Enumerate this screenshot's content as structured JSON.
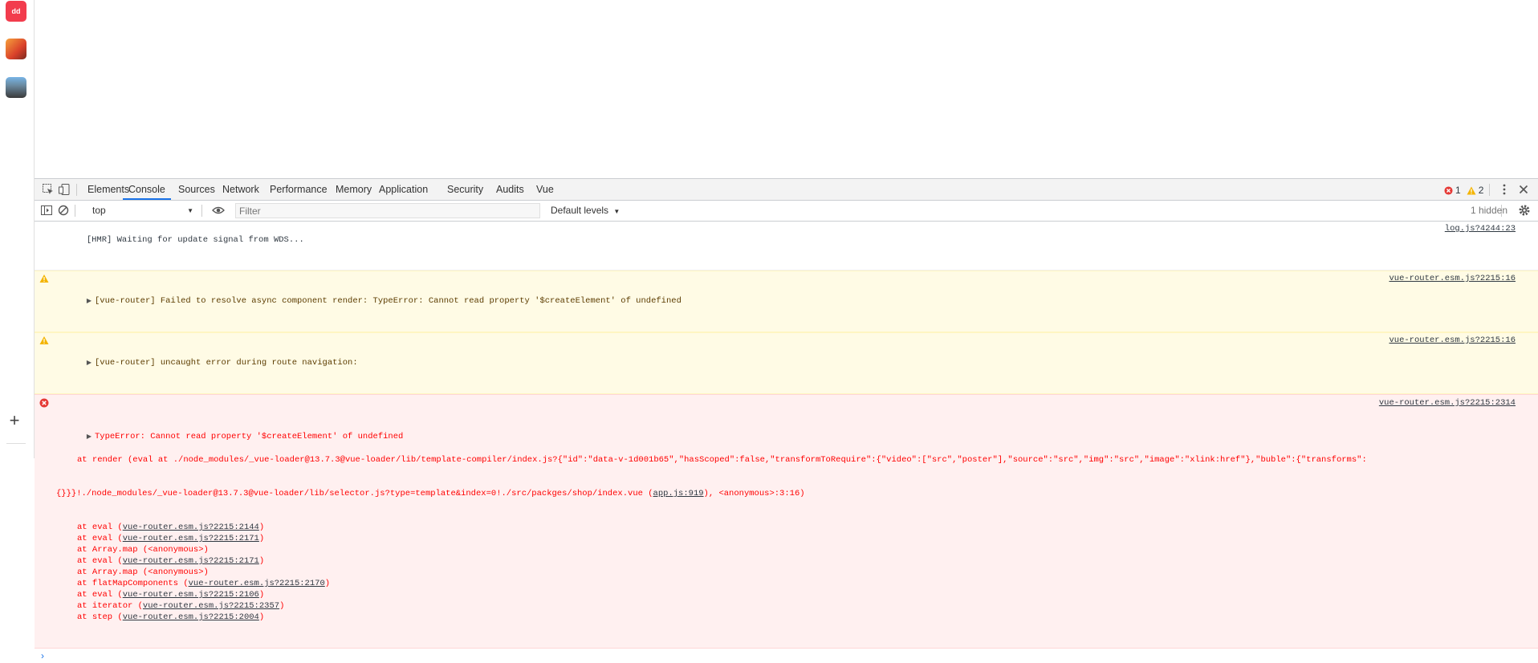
{
  "sidebar": {
    "apps": [
      {
        "name": "app-1",
        "label": "dd"
      },
      {
        "name": "app-2",
        "label": ""
      },
      {
        "name": "app-3",
        "label": ""
      }
    ],
    "add_label": "+"
  },
  "devtools": {
    "tabs": [
      "Elements",
      "Console",
      "Sources",
      "Network",
      "Performance",
      "Memory",
      "Application",
      "Security",
      "Audits",
      "Vue"
    ],
    "active_tab": "Console",
    "error_count": "1",
    "warning_count": "2",
    "toolbar": {
      "context": "top",
      "filter_placeholder": "Filter",
      "levels": "Default levels",
      "hidden": "1 hidden"
    }
  },
  "console": {
    "log1": {
      "text": "[HMR] Waiting for update signal from WDS...",
      "source": "log.js?4244:23"
    },
    "warn1": {
      "text": "[vue-router] Failed to resolve async component render: TypeError: Cannot read property '$createElement' of undefined",
      "source": "vue-router.esm.js?2215:16"
    },
    "warn2": {
      "text": "[vue-router] uncaught error during route navigation:",
      "source": "vue-router.esm.js?2215:16"
    },
    "error": {
      "text": "TypeError: Cannot read property '$createElement' of undefined",
      "source": "vue-router.esm.js?2215:2314",
      "render_line_a": "at render (eval at ./node_modules/_vue-loader@13.7.3@vue-loader/lib/template-compiler/index.js?{\"id\":\"data-v-1d001b65\",\"hasScoped\":false,\"transformToRequire\":{\"video\":[\"src\",\"poster\"],\"source\":\"src\",\"img\":\"src\",\"image\":\"xlink:href\"},\"buble\":{\"transforms\":",
      "render_line_b": "{}}}!./node_modules/_vue-loader@13.7.3@vue-loader/lib/selector.js?type=template&index=0!./src/packges/shop/index.vue (",
      "render_link": "app.js:919",
      "render_line_c": "), <anonymous>:3:16)",
      "stack": [
        {
          "pre": "at eval (",
          "link": "vue-router.esm.js?2215:2144",
          "post": ")"
        },
        {
          "pre": "at eval (",
          "link": "vue-router.esm.js?2215:2171",
          "post": ")"
        },
        {
          "pre": "at Array.map (<anonymous>)",
          "link": "",
          "post": ""
        },
        {
          "pre": "at eval (",
          "link": "vue-router.esm.js?2215:2171",
          "post": ")"
        },
        {
          "pre": "at Array.map (<anonymous>)",
          "link": "",
          "post": ""
        },
        {
          "pre": "at flatMapComponents (",
          "link": "vue-router.esm.js?2215:2170",
          "post": ")"
        },
        {
          "pre": "at eval (",
          "link": "vue-router.esm.js?2215:2106",
          "post": ")"
        },
        {
          "pre": "at iterator (",
          "link": "vue-router.esm.js?2215:2357",
          "post": ")"
        },
        {
          "pre": "at step (",
          "link": "vue-router.esm.js?2215:2004",
          "post": ")"
        }
      ]
    },
    "prompt": "›"
  }
}
